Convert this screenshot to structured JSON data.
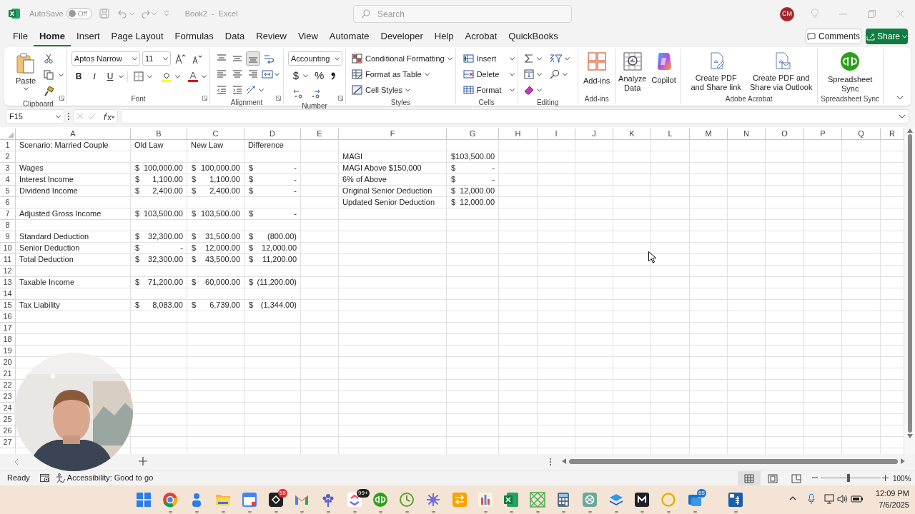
{
  "title_bar": {
    "autosave_label": "AutoSave",
    "autosave": {
      "on": false,
      "label": "Off"
    },
    "document_title": "Book2  -  Excel",
    "search_placeholder": "Search",
    "user_initials": "CM"
  },
  "menu_tabs": [
    {
      "label": "File",
      "selected": false
    },
    {
      "label": "Home",
      "selected": true
    },
    {
      "label": "Insert",
      "selected": false
    },
    {
      "label": "Page Layout",
      "selected": false
    },
    {
      "label": "Formulas",
      "selected": false
    },
    {
      "label": "Data",
      "selected": false
    },
    {
      "label": "Review",
      "selected": false
    },
    {
      "label": "View",
      "selected": false
    },
    {
      "label": "Automate",
      "selected": false
    },
    {
      "label": "Developer",
      "selected": false
    },
    {
      "label": "Help",
      "selected": false
    },
    {
      "label": "Acrobat",
      "selected": false
    },
    {
      "label": "QuickBooks",
      "selected": false
    }
  ],
  "comments_button": "Comments",
  "share_button": "Share",
  "ribbon": {
    "clipboard": {
      "paste": "Paste",
      "group": "Clipboard"
    },
    "font": {
      "name": "Aptos Narrow",
      "size": "11",
      "bold": "B",
      "italic": "I",
      "underline": "U",
      "group": "Font"
    },
    "alignment": {
      "group": "Alignment"
    },
    "number": {
      "format": "Accounting",
      "currency": "$",
      "percent": "%",
      "group": "Number"
    },
    "styles": {
      "items": [
        "Conditional Formatting",
        "Format as Table",
        "Cell Styles"
      ],
      "group": "Styles"
    },
    "cells": {
      "items": [
        "Insert",
        "Delete",
        "Format"
      ],
      "group": "Cells"
    },
    "editing": {
      "group": "Editing"
    },
    "addins": {
      "button": "Add-ins",
      "group": "Add-ins"
    },
    "analyze": {
      "analyze_data": "Analyze\nData",
      "copilot": "Copilot"
    },
    "acrobat": {
      "items": [
        "Create PDF\nand Share link",
        "Create PDF and\nShare via Outlook"
      ],
      "group": "Adobe Acrobat"
    },
    "sync": {
      "button": "Spreadsheet\nSync",
      "group": "Spreadsheet Sync"
    }
  },
  "formula_bar": {
    "name_box": "F15"
  },
  "sheet": {
    "columns": [
      "A",
      "B",
      "C",
      "D",
      "E",
      "F",
      "G",
      "H",
      "I",
      "J",
      "K",
      "L",
      "M",
      "N",
      "O",
      "P",
      "Q",
      "R"
    ],
    "rows": [
      {
        "number": "1",
        "cells": [
          "Scenario: Married Couple",
          "Old Law",
          "New Law",
          "Difference"
        ]
      },
      {
        "number": "2",
        "cells": [
          "",
          "",
          "",
          "",
          "",
          "MAGI",
          {
            "currency": "$",
            "amount": "103,500.00"
          }
        ]
      },
      {
        "number": "3",
        "cells": [
          "Wages",
          {
            "currency": "$",
            "amount": "100,000.00"
          },
          {
            "currency": "$",
            "amount": "100,000.00"
          },
          {
            "currency": "$",
            "amount": "-"
          },
          "",
          "MAGI Above $150,000",
          {
            "currency": "$",
            "amount": "-"
          }
        ]
      },
      {
        "number": "4",
        "cells": [
          "Interest Income",
          {
            "currency": "$",
            "amount": "1,100.00"
          },
          {
            "currency": "$",
            "amount": "1,100.00"
          },
          {
            "currency": "$",
            "amount": "-"
          },
          "",
          "6% of Above",
          {
            "currency": "$",
            "amount": "-"
          }
        ]
      },
      {
        "number": "5",
        "cells": [
          "Dividend Income",
          {
            "currency": "$",
            "amount": "2,400.00"
          },
          {
            "currency": "$",
            "amount": "2,400.00"
          },
          {
            "currency": "$",
            "amount": "-"
          },
          "",
          "Original Senior Deduction",
          {
            "currency": "$",
            "amount": "12,000.00"
          }
        ]
      },
      {
        "number": "6",
        "cells": [
          "",
          "",
          "",
          "",
          "",
          "Updated Senior Deduction",
          {
            "currency": "$",
            "amount": "12,000.00"
          }
        ]
      },
      {
        "number": "7",
        "cells": [
          "Adjusted Gross Income",
          {
            "currency": "$",
            "amount": "103,500.00"
          },
          {
            "currency": "$",
            "amount": "103,500.00"
          },
          {
            "currency": "$",
            "amount": "-"
          }
        ]
      },
      {
        "number": "8"
      },
      {
        "number": "9",
        "cells": [
          "Standard Deduction",
          {
            "currency": "$",
            "amount": "32,300.00"
          },
          {
            "currency": "$",
            "amount": "31,500.00"
          },
          {
            "currency": "$",
            "amount": "(800.00)"
          }
        ]
      },
      {
        "number": "10",
        "cells": [
          "Senior Deduction",
          {
            "currency": "$",
            "amount": "-"
          },
          {
            "currency": "$",
            "amount": "12,000.00"
          },
          {
            "currency": "$",
            "amount": "12,000.00"
          }
        ]
      },
      {
        "number": "11",
        "cells": [
          "Total Deduction",
          {
            "currency": "$",
            "amount": "32,300.00"
          },
          {
            "currency": "$",
            "amount": "43,500.00"
          },
          {
            "currency": "$",
            "amount": "11,200.00"
          }
        ]
      },
      {
        "number": "12"
      },
      {
        "number": "13",
        "cells": [
          "Taxable Income",
          {
            "currency": "$",
            "amount": "71,200.00"
          },
          {
            "currency": "$",
            "amount": "60,000.00"
          },
          {
            "currency": "$",
            "amount": "(11,200.00)"
          }
        ]
      },
      {
        "number": "14"
      },
      {
        "number": "15",
        "cells": [
          "Tax Liability",
          {
            "currency": "$",
            "amount": "8,083.00"
          },
          {
            "currency": "$",
            "amount": "6,739.00"
          },
          {
            "currency": "$",
            "amount": "(1,344.00)"
          }
        ]
      },
      {
        "number": "16"
      },
      {
        "number": "17"
      },
      {
        "number": "18"
      },
      {
        "number": "19"
      },
      {
        "number": "20"
      },
      {
        "number": "21"
      },
      {
        "number": "22"
      },
      {
        "number": "23"
      },
      {
        "number": "24"
      },
      {
        "number": "25"
      },
      {
        "number": "26"
      },
      {
        "number": "27"
      }
    ]
  },
  "status_bar": {
    "mode": "Ready",
    "accessibility": "Accessibility: Good to go",
    "views": [
      {
        "selected": true
      },
      {
        "selected": false
      },
      {
        "selected": false
      }
    ],
    "zoom": {
      "level": 0.47,
      "label": "100%"
    }
  },
  "taskbar": {
    "badges": [
      "55",
      "99+",
      "65"
    ],
    "time": "12:09 PM",
    "date": "7/6/2025"
  }
}
